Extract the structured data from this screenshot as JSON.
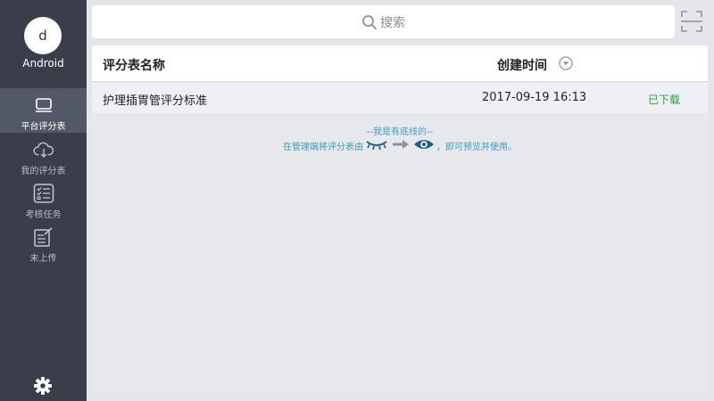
{
  "user": {
    "avatar_letter": "d",
    "name": "Android"
  },
  "nav": [
    {
      "label": "平台评分表",
      "icon": "tablet-icon",
      "active": true
    },
    {
      "label": "我的评分表",
      "icon": "cloud-download-icon",
      "active": false
    },
    {
      "label": "考核任务",
      "icon": "checklist-icon",
      "active": false
    },
    {
      "label": "未上传",
      "icon": "edit-note-icon",
      "active": false
    }
  ],
  "search": {
    "placeholder": "搜索"
  },
  "table": {
    "headers": {
      "name": "评分表名称",
      "time": "创建时间"
    },
    "rows": [
      {
        "name": "护理插胃管评分标准",
        "time": "2017-09-19 16:13",
        "status": "已下载"
      }
    ]
  },
  "footer": {
    "line1": "--我是有底线的--",
    "line2_prefix": "在管理端将评分表由",
    "line2_suffix": "，即可预览并使用。"
  },
  "colors": {
    "sidebar_bg": "#3a3e4a",
    "sidebar_active": "#535866",
    "status_green": "#2e9e4a",
    "note_blue": "#3d9dc0",
    "eye_blue": "#1a5f8a"
  }
}
